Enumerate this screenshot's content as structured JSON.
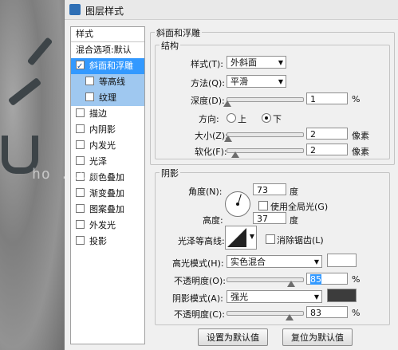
{
  "window": {
    "title": "图层样式"
  },
  "sidebar": {
    "header": "样式",
    "items": [
      {
        "label": "混合选项:默认",
        "checkbox": false,
        "state": "normal"
      },
      {
        "label": "斜面和浮雕",
        "checkbox": true,
        "checked": true,
        "state": "selected"
      },
      {
        "label": "等高线",
        "checkbox": true,
        "checked": false,
        "state": "sub"
      },
      {
        "label": "纹理",
        "checkbox": true,
        "checked": false,
        "state": "sub"
      },
      {
        "label": "描边",
        "checkbox": true,
        "checked": false,
        "state": "normal"
      },
      {
        "label": "内阴影",
        "checkbox": true,
        "checked": false,
        "state": "normal"
      },
      {
        "label": "内发光",
        "checkbox": true,
        "checked": false,
        "state": "normal"
      },
      {
        "label": "光泽",
        "checkbox": true,
        "checked": false,
        "state": "normal"
      },
      {
        "label": "颜色叠加",
        "checkbox": true,
        "checked": false,
        "state": "normal"
      },
      {
        "label": "渐变叠加",
        "checkbox": true,
        "checked": false,
        "state": "normal"
      },
      {
        "label": "图案叠加",
        "checkbox": true,
        "checked": false,
        "state": "normal"
      },
      {
        "label": "外发光",
        "checkbox": true,
        "checked": false,
        "state": "normal"
      },
      {
        "label": "投影",
        "checkbox": true,
        "checked": false,
        "state": "normal"
      }
    ]
  },
  "bevel": {
    "group_title": "斜面和浮雕",
    "structure": {
      "title": "结构",
      "style_label": "样式(T):",
      "style_value": "外斜面",
      "method_label": "方法(Q):",
      "method_value": "平滑",
      "depth_label": "深度(D):",
      "depth_value": "1",
      "depth_unit": "%",
      "depth_level": 0.01,
      "direction_label": "方向:",
      "dir_up": "上",
      "dir_down": "下",
      "direction_selected": "下",
      "size_label": "大小(Z):",
      "size_value": "2",
      "size_unit": "像素",
      "size_level": 0.02,
      "soften_label": "软化(F):",
      "soften_value": "2",
      "soften_unit": "像素",
      "soften_level": 0.12
    },
    "shading": {
      "title": "阴影",
      "angle_label": "角度(N):",
      "angle_value": "73",
      "angle_unit": "度",
      "global_light_label": "使用全局光(G)",
      "global_light_checked": false,
      "altitude_label": "高度:",
      "altitude_value": "37",
      "altitude_unit": "度",
      "gloss_contour_label": "光泽等高线:",
      "antialias_label": "消除锯齿(L)",
      "antialias_checked": false,
      "highlight_mode_label": "高光模式(H):",
      "highlight_mode_value": "实色混合",
      "highlight_color": "#ffffff",
      "highlight_opacity_label": "不透明度(O):",
      "highlight_opacity_value": "85",
      "opacity_unit": "%",
      "highlight_opacity_level": 0.85,
      "shadow_mode_label": "阴影模式(A):",
      "shadow_mode_value": "强光",
      "shadow_color": "#3c3c3c",
      "shadow_opacity_label": "不透明度(C):",
      "shadow_opacity_value": "83",
      "shadow_opacity_level": 0.83
    }
  },
  "buttons": {
    "set_default": "设置为默认值",
    "reset_default": "复位为默认值"
  },
  "watermark": "ho                         .com",
  "colors": {
    "selected": "#3399ff",
    "sub_selected": "#9fc8f0",
    "dialog_bg": "#f0f0f0"
  }
}
